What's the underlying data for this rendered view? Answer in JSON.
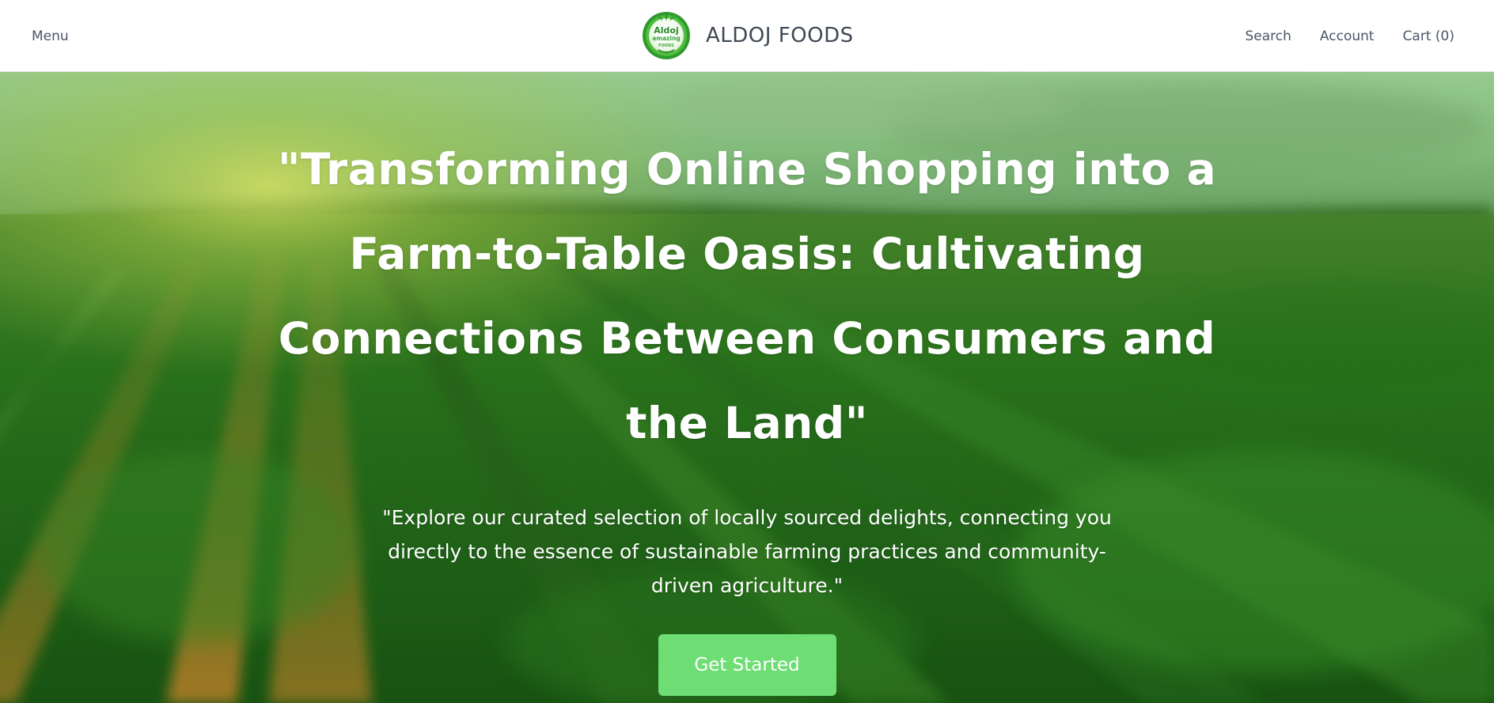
{
  "header": {
    "menu_label": "Menu",
    "brand_name": "ALDOJ FOODS",
    "logo_text": {
      "line1": "Aldoj",
      "line2": "amazing",
      "line3": "FOODS"
    },
    "search_label": "Search",
    "account_label": "Account",
    "cart_label": "Cart (0)"
  },
  "hero": {
    "title": "\"Transforming Online Shopping into a Farm-to-Table Oasis: Cultivating Connections Between Consumers and the Land\"",
    "subtitle": "\"Explore our curated selection of locally sourced delights, connecting you directly to the essence of sustainable farming practices and community-driven agriculture.\"",
    "cta_label": "Get Started"
  },
  "colors": {
    "accent": "#6ddd74",
    "nav_text": "#4a5568",
    "brand_text": "#3f4854",
    "hero_text": "#ffffff"
  },
  "icons": {
    "logo": "aldoj-leaf-badge-icon"
  }
}
